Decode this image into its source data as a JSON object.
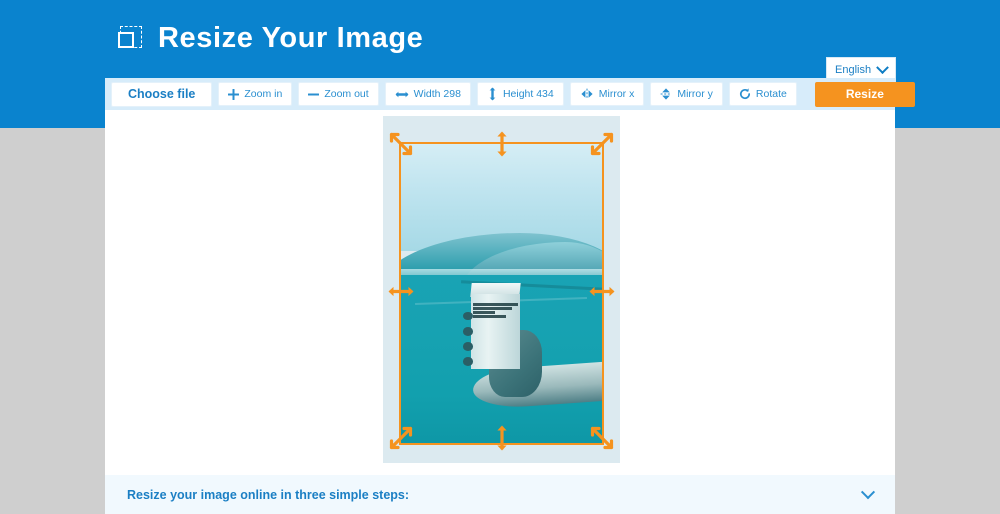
{
  "header": {
    "title": "Resize Your Image",
    "logo_icon": "crop-frame-icon",
    "bg_color": "#0a83ce"
  },
  "language_select": {
    "value": "English",
    "icon": "chevron-down-icon"
  },
  "toolbar": {
    "bg_color": "#d7ecfa",
    "choose_file_label": "Choose file",
    "buttons": [
      {
        "label": "Zoom in",
        "icon": "plus-icon"
      },
      {
        "label": "Zoom out",
        "icon": "minus-icon"
      },
      {
        "label": "Width 298",
        "icon": "arrows-horizontal-icon"
      },
      {
        "label": "Height 434",
        "icon": "arrows-vertical-icon"
      },
      {
        "label": "Mirror x",
        "icon": "mirror-horizontal-icon"
      },
      {
        "label": "Mirror y",
        "icon": "mirror-vertical-icon"
      },
      {
        "label": "Rotate",
        "icon": "rotate-icon"
      }
    ],
    "resize_label": "Resize",
    "resize_color": "#f5931f"
  },
  "editor": {
    "image_alt": "Hand holding a carton underwater in turquoise sea",
    "selection_color": "#f5931f",
    "handle_icon": "resize-arrow-handle-icon",
    "stage_bg": "#dceaf0"
  },
  "accordion": {
    "title": "Resize your image online in three simple steps:",
    "icon": "chevron-down-icon"
  }
}
